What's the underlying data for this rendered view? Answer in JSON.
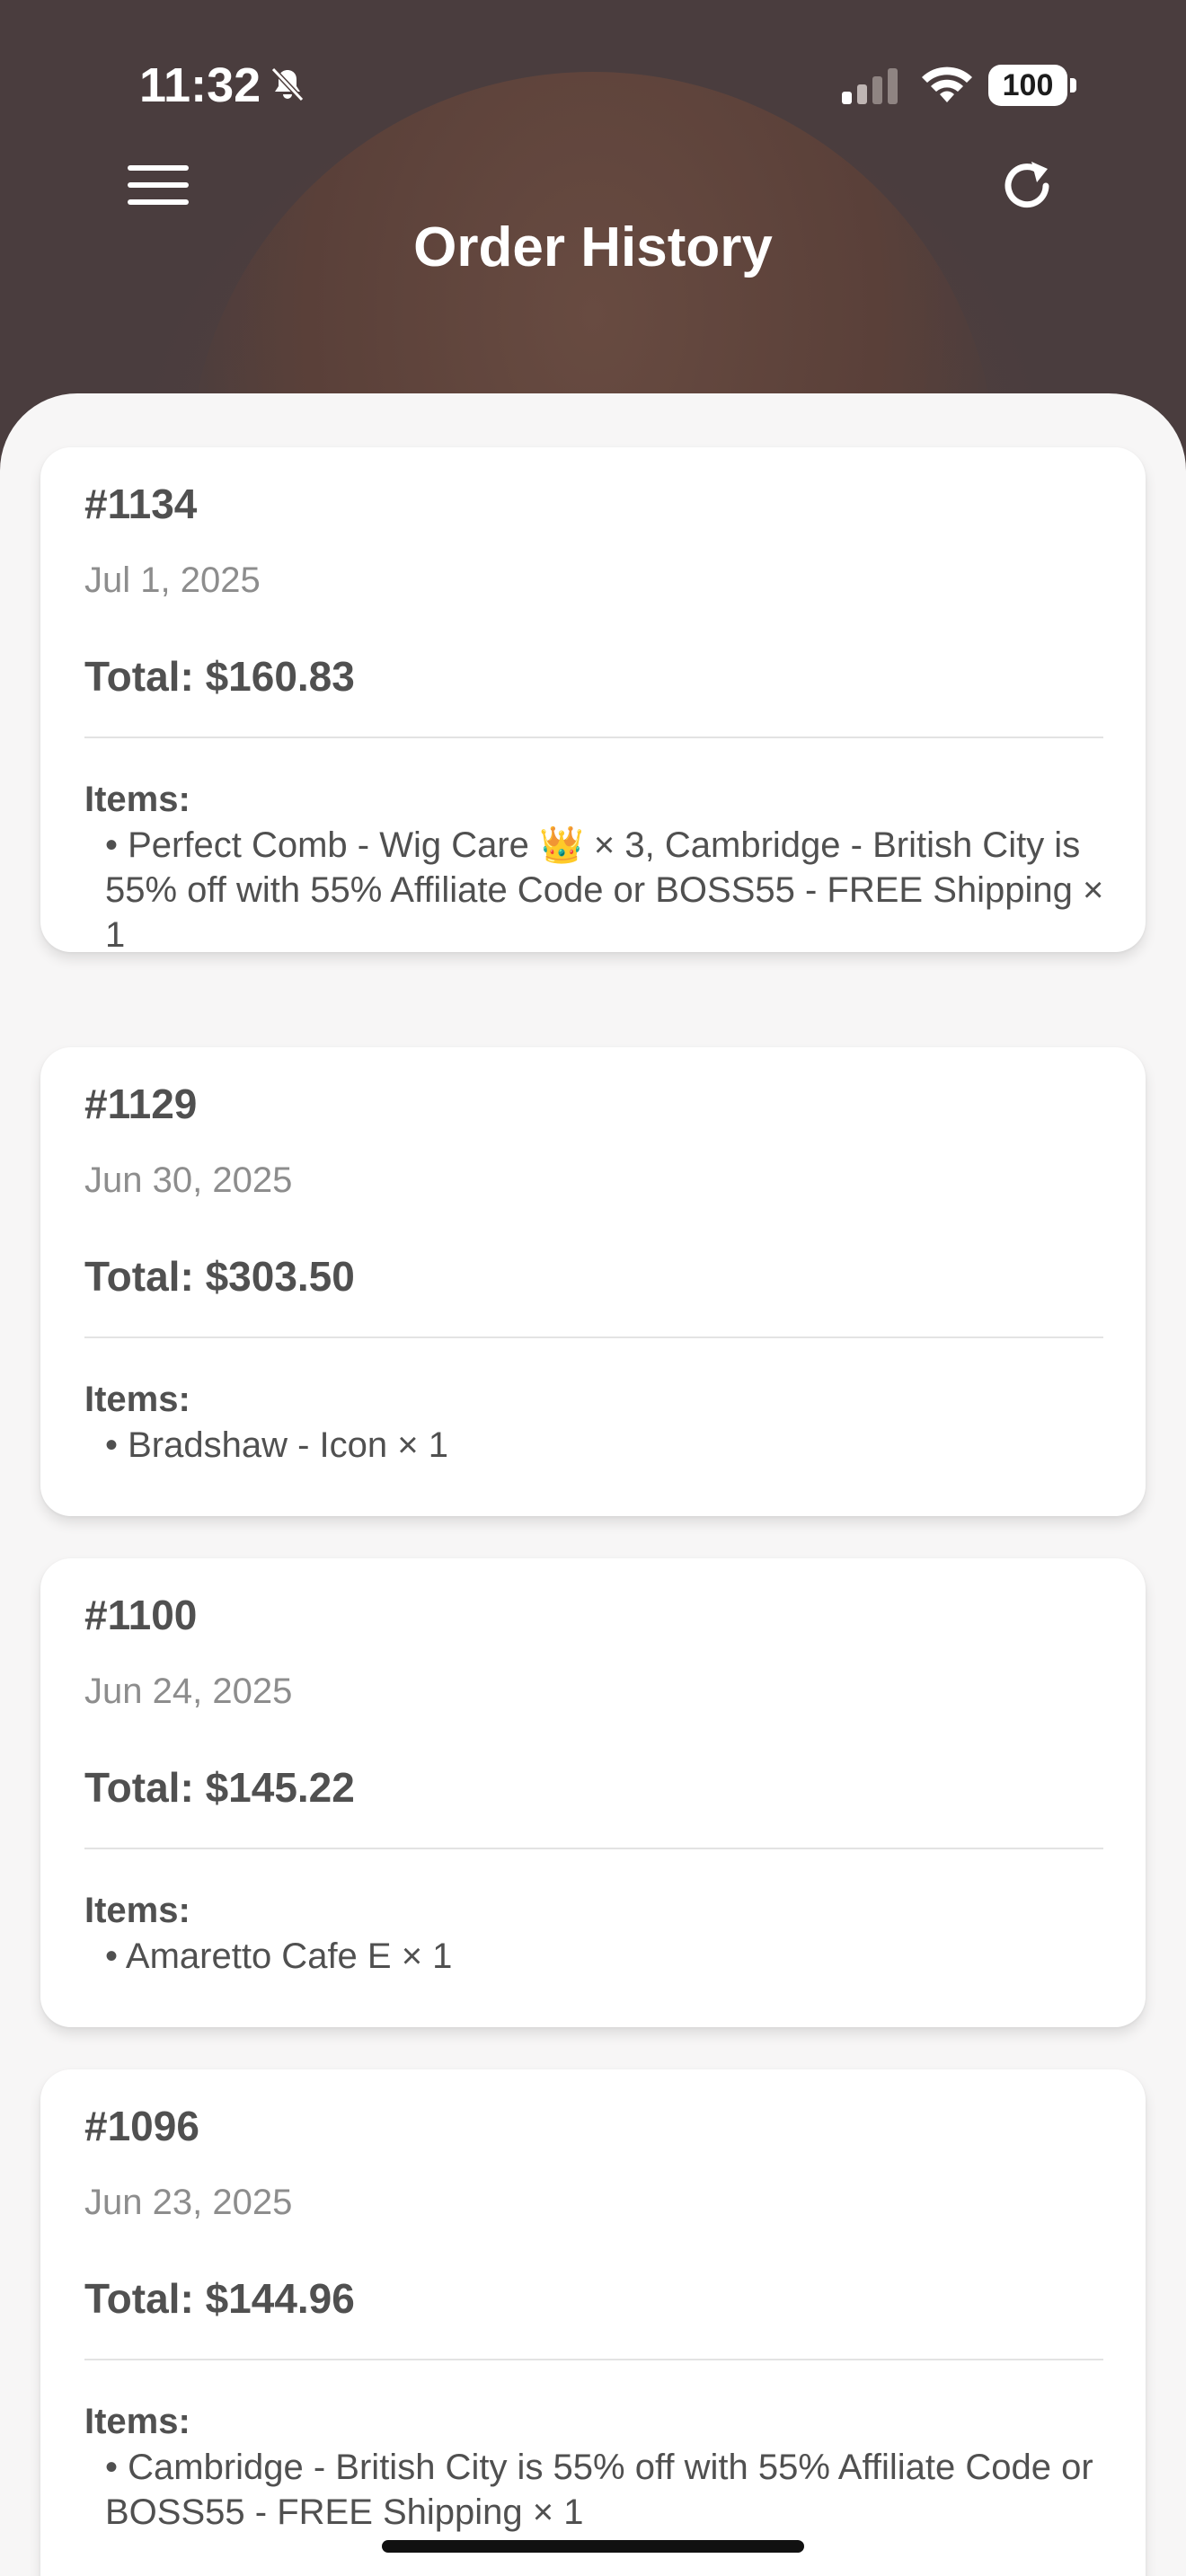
{
  "status_bar": {
    "time": "11:32",
    "battery": "100"
  },
  "header": {
    "title": "Order History"
  },
  "orders": [
    {
      "id": "#1134",
      "date": "Jul 1, 2025",
      "total": "Total: $160.83",
      "items_label": "Items:",
      "items": "• Perfect Comb - Wig Care 👑 × 3, Cambridge - British City is 55% off with 55% Affiliate Code or BOSS55 - FREE Shipping × 1"
    },
    {
      "id": "#1129",
      "date": "Jun 30, 2025",
      "total": "Total: $303.50",
      "items_label": "Items:",
      "items": "• Bradshaw - Icon × 1"
    },
    {
      "id": "#1100",
      "date": "Jun 24, 2025",
      "total": "Total: $145.22",
      "items_label": "Items:",
      "items": "• Amaretto Cafe E × 1"
    },
    {
      "id": "#1096",
      "date": "Jun 23, 2025",
      "total": "Total: $144.96",
      "items_label": "Items:",
      "items": "• Cambridge - British City is 55% off with 55% Affiliate Code or BOSS55 - FREE Shipping × 1"
    }
  ],
  "icons": [
    "bell-slash-icon",
    "cellular-signal-icon",
    "wifi-icon",
    "battery-icon",
    "hamburger-menu-icon",
    "refresh-icon"
  ],
  "colors": {
    "sheet_background": "#f7f6f6",
    "card_background": "#ffffff",
    "text_primary": "#505050",
    "text_secondary": "#8d8d8d"
  }
}
